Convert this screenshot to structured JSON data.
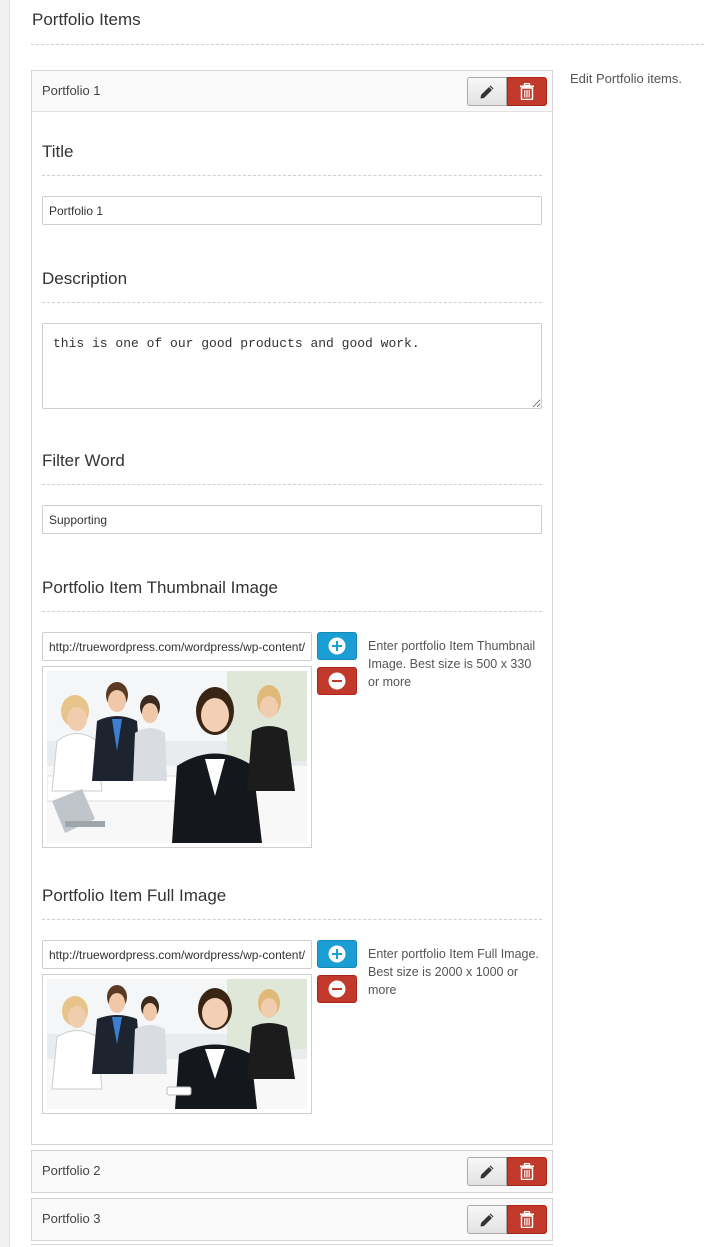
{
  "section": {
    "title": "Portfolio Items",
    "description": "Edit Portfolio items."
  },
  "items": [
    {
      "title": "Portfolio 1",
      "fields": {
        "title_label": "Title",
        "title_value": "Portfolio 1",
        "description_label": "Description",
        "description_value": "this is one of our good products and good work.",
        "filter_label": "Filter Word",
        "filter_value": "Supporting",
        "thumb_label": "Portfolio Item Thumbnail Image",
        "thumb_url": "http://truewordpress.com/wordpress/wp-content/uploads/",
        "thumb_help": "Enter portfolio Item Thumbnail Image. Best size is 500 x 330 or more",
        "full_label": "Portfolio Item Full Image",
        "full_url": "http://truewordpress.com/wordpress/wp-content/uploads/",
        "full_help": "Enter portfolio Item Full Image. Best size is 2000 x 1000 or more"
      }
    },
    {
      "title": "Portfolio 2"
    },
    {
      "title": "Portfolio 3"
    }
  ],
  "icons": {
    "edit": "pencil-icon",
    "delete": "trash-icon",
    "add": "plus-circle-icon",
    "remove": "minus-circle-icon"
  },
  "colors": {
    "delete_button": "#c0392b",
    "add_button": "#1b9ed3"
  }
}
